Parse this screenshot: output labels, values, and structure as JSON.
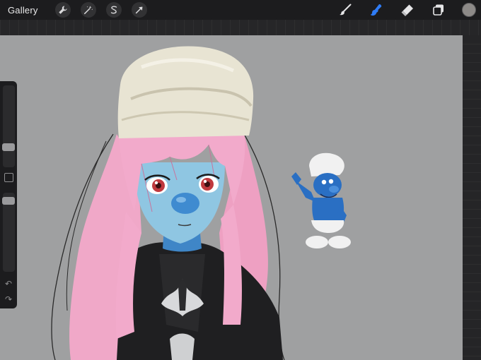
{
  "toolbar": {
    "gallery_label": "Gallery",
    "left_tools": [
      {
        "name": "actions-wrench-icon"
      },
      {
        "name": "adjustments-wand-icon"
      },
      {
        "name": "selection-s-icon"
      },
      {
        "name": "transform-arrow-icon"
      }
    ],
    "right_tools": [
      {
        "name": "brush-icon",
        "active": false
      },
      {
        "name": "smudge-icon",
        "active": true
      },
      {
        "name": "eraser-icon",
        "active": false
      },
      {
        "name": "layers-icon",
        "active": false
      }
    ],
    "current_color": "#8d8a88",
    "accent_color": "#2f7cf6"
  },
  "sidebar": {
    "brush_size_level": 0.28,
    "opacity_level": 0.07,
    "undo_icon": "undo-arrow-icon",
    "redo_icon": "redo-arrow-icon"
  },
  "canvas": {
    "background_color": "#9fa0a1"
  }
}
